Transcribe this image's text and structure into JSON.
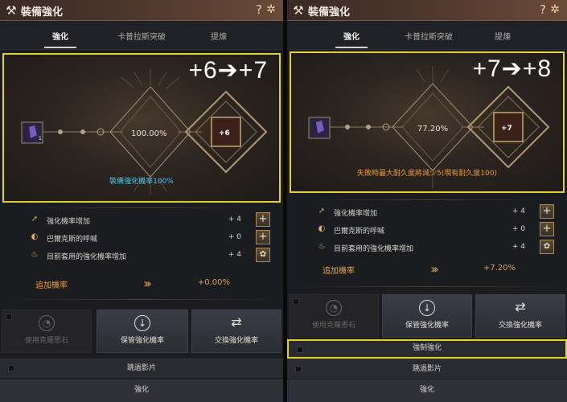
{
  "left": {
    "title": "裝備強化",
    "tabs": [
      "強化",
      "卡普拉斯突破",
      "提煉"
    ],
    "big_label": "+6➔+7",
    "success_rate": "100.00%",
    "level_badge": "+6",
    "item_slot_count": "1",
    "note": "裝備強化機率100%",
    "note_color": "#4fc7ec",
    "rows": [
      {
        "label": "強化機率增加",
        "value": "+ 4",
        "button": "+"
      },
      {
        "label": "巴爾克斯的呼喊",
        "value": "+ 0",
        "button": "+"
      },
      {
        "label": "目前套用的強化機率增加",
        "value": "+ 4",
        "button": "✿"
      }
    ],
    "extra_label": "追加機率",
    "extra_value": "+0.00%",
    "actions": [
      "使用克羅恩石",
      "保管強化機率",
      "交換強化機率"
    ],
    "skip_label": "跳過影片",
    "submit_label": "強化"
  },
  "right": {
    "title": "裝備強化",
    "tabs": [
      "強化",
      "卡普拉斯突破",
      "提煉"
    ],
    "big_label": "+7➔+8",
    "success_rate": "77.20%",
    "level_badge": "+7",
    "note": "失敗時最大耐久度將減少5(現有耐久度100)",
    "note_color": "#e89a3c",
    "rows": [
      {
        "label": "強化機率增加",
        "value": "+ 4",
        "button": "+"
      },
      {
        "label": "巴爾克斯的呼喊",
        "value": "+ 0",
        "button": "+"
      },
      {
        "label": "目前套用的強化機率增加",
        "value": "+ 4",
        "button": "✿"
      }
    ],
    "extra_label": "追加機率",
    "extra_value": "+7.20%",
    "actions": [
      "使用克羅恩石",
      "保管強化機率",
      "交換強化機率"
    ],
    "force_label": "強制強化",
    "skip_label": "跳過影片",
    "submit_label": "強化"
  },
  "colors": {
    "highlight": "#e2d32b",
    "accent": "#e0a050"
  },
  "icons": {
    "app": "hammer-wrench-icon",
    "help": "question-icon",
    "settings": "gear-icon",
    "rows": [
      "arrow-up-icon",
      "moon-orb-icon",
      "flame-icon"
    ],
    "actions": [
      "crone-stone-icon",
      "down-arrow-circle-icon",
      "swap-arrows-icon"
    ]
  }
}
